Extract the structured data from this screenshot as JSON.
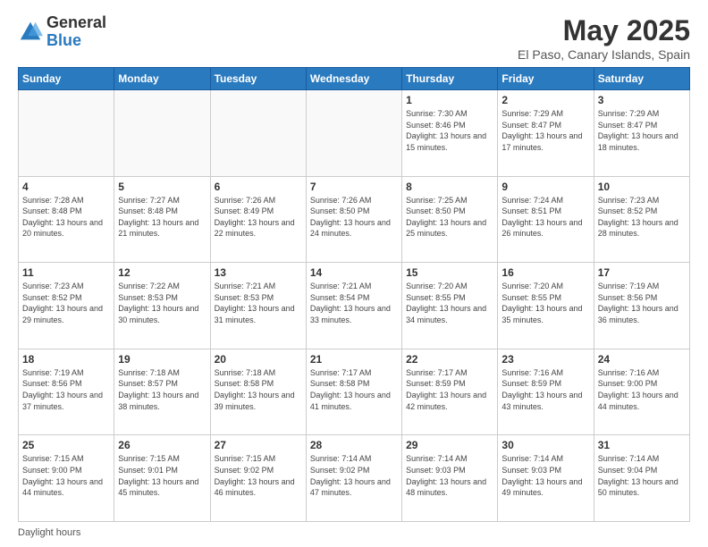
{
  "logo": {
    "general": "General",
    "blue": "Blue"
  },
  "title": "May 2025",
  "location": "El Paso, Canary Islands, Spain",
  "days_of_week": [
    "Sunday",
    "Monday",
    "Tuesday",
    "Wednesday",
    "Thursday",
    "Friday",
    "Saturday"
  ],
  "footer": "Daylight hours",
  "weeks": [
    [
      {
        "day": "",
        "info": ""
      },
      {
        "day": "",
        "info": ""
      },
      {
        "day": "",
        "info": ""
      },
      {
        "day": "",
        "info": ""
      },
      {
        "day": "1",
        "info": "Sunrise: 7:30 AM\nSunset: 8:46 PM\nDaylight: 13 hours and 15 minutes."
      },
      {
        "day": "2",
        "info": "Sunrise: 7:29 AM\nSunset: 8:47 PM\nDaylight: 13 hours and 17 minutes."
      },
      {
        "day": "3",
        "info": "Sunrise: 7:29 AM\nSunset: 8:47 PM\nDaylight: 13 hours and 18 minutes."
      }
    ],
    [
      {
        "day": "4",
        "info": "Sunrise: 7:28 AM\nSunset: 8:48 PM\nDaylight: 13 hours and 20 minutes."
      },
      {
        "day": "5",
        "info": "Sunrise: 7:27 AM\nSunset: 8:48 PM\nDaylight: 13 hours and 21 minutes."
      },
      {
        "day": "6",
        "info": "Sunrise: 7:26 AM\nSunset: 8:49 PM\nDaylight: 13 hours and 22 minutes."
      },
      {
        "day": "7",
        "info": "Sunrise: 7:26 AM\nSunset: 8:50 PM\nDaylight: 13 hours and 24 minutes."
      },
      {
        "day": "8",
        "info": "Sunrise: 7:25 AM\nSunset: 8:50 PM\nDaylight: 13 hours and 25 minutes."
      },
      {
        "day": "9",
        "info": "Sunrise: 7:24 AM\nSunset: 8:51 PM\nDaylight: 13 hours and 26 minutes."
      },
      {
        "day": "10",
        "info": "Sunrise: 7:23 AM\nSunset: 8:52 PM\nDaylight: 13 hours and 28 minutes."
      }
    ],
    [
      {
        "day": "11",
        "info": "Sunrise: 7:23 AM\nSunset: 8:52 PM\nDaylight: 13 hours and 29 minutes."
      },
      {
        "day": "12",
        "info": "Sunrise: 7:22 AM\nSunset: 8:53 PM\nDaylight: 13 hours and 30 minutes."
      },
      {
        "day": "13",
        "info": "Sunrise: 7:21 AM\nSunset: 8:53 PM\nDaylight: 13 hours and 31 minutes."
      },
      {
        "day": "14",
        "info": "Sunrise: 7:21 AM\nSunset: 8:54 PM\nDaylight: 13 hours and 33 minutes."
      },
      {
        "day": "15",
        "info": "Sunrise: 7:20 AM\nSunset: 8:55 PM\nDaylight: 13 hours and 34 minutes."
      },
      {
        "day": "16",
        "info": "Sunrise: 7:20 AM\nSunset: 8:55 PM\nDaylight: 13 hours and 35 minutes."
      },
      {
        "day": "17",
        "info": "Sunrise: 7:19 AM\nSunset: 8:56 PM\nDaylight: 13 hours and 36 minutes."
      }
    ],
    [
      {
        "day": "18",
        "info": "Sunrise: 7:19 AM\nSunset: 8:56 PM\nDaylight: 13 hours and 37 minutes."
      },
      {
        "day": "19",
        "info": "Sunrise: 7:18 AM\nSunset: 8:57 PM\nDaylight: 13 hours and 38 minutes."
      },
      {
        "day": "20",
        "info": "Sunrise: 7:18 AM\nSunset: 8:58 PM\nDaylight: 13 hours and 39 minutes."
      },
      {
        "day": "21",
        "info": "Sunrise: 7:17 AM\nSunset: 8:58 PM\nDaylight: 13 hours and 41 minutes."
      },
      {
        "day": "22",
        "info": "Sunrise: 7:17 AM\nSunset: 8:59 PM\nDaylight: 13 hours and 42 minutes."
      },
      {
        "day": "23",
        "info": "Sunrise: 7:16 AM\nSunset: 8:59 PM\nDaylight: 13 hours and 43 minutes."
      },
      {
        "day": "24",
        "info": "Sunrise: 7:16 AM\nSunset: 9:00 PM\nDaylight: 13 hours and 44 minutes."
      }
    ],
    [
      {
        "day": "25",
        "info": "Sunrise: 7:15 AM\nSunset: 9:00 PM\nDaylight: 13 hours and 44 minutes."
      },
      {
        "day": "26",
        "info": "Sunrise: 7:15 AM\nSunset: 9:01 PM\nDaylight: 13 hours and 45 minutes."
      },
      {
        "day": "27",
        "info": "Sunrise: 7:15 AM\nSunset: 9:02 PM\nDaylight: 13 hours and 46 minutes."
      },
      {
        "day": "28",
        "info": "Sunrise: 7:14 AM\nSunset: 9:02 PM\nDaylight: 13 hours and 47 minutes."
      },
      {
        "day": "29",
        "info": "Sunrise: 7:14 AM\nSunset: 9:03 PM\nDaylight: 13 hours and 48 minutes."
      },
      {
        "day": "30",
        "info": "Sunrise: 7:14 AM\nSunset: 9:03 PM\nDaylight: 13 hours and 49 minutes."
      },
      {
        "day": "31",
        "info": "Sunrise: 7:14 AM\nSunset: 9:04 PM\nDaylight: 13 hours and 50 minutes."
      }
    ]
  ]
}
